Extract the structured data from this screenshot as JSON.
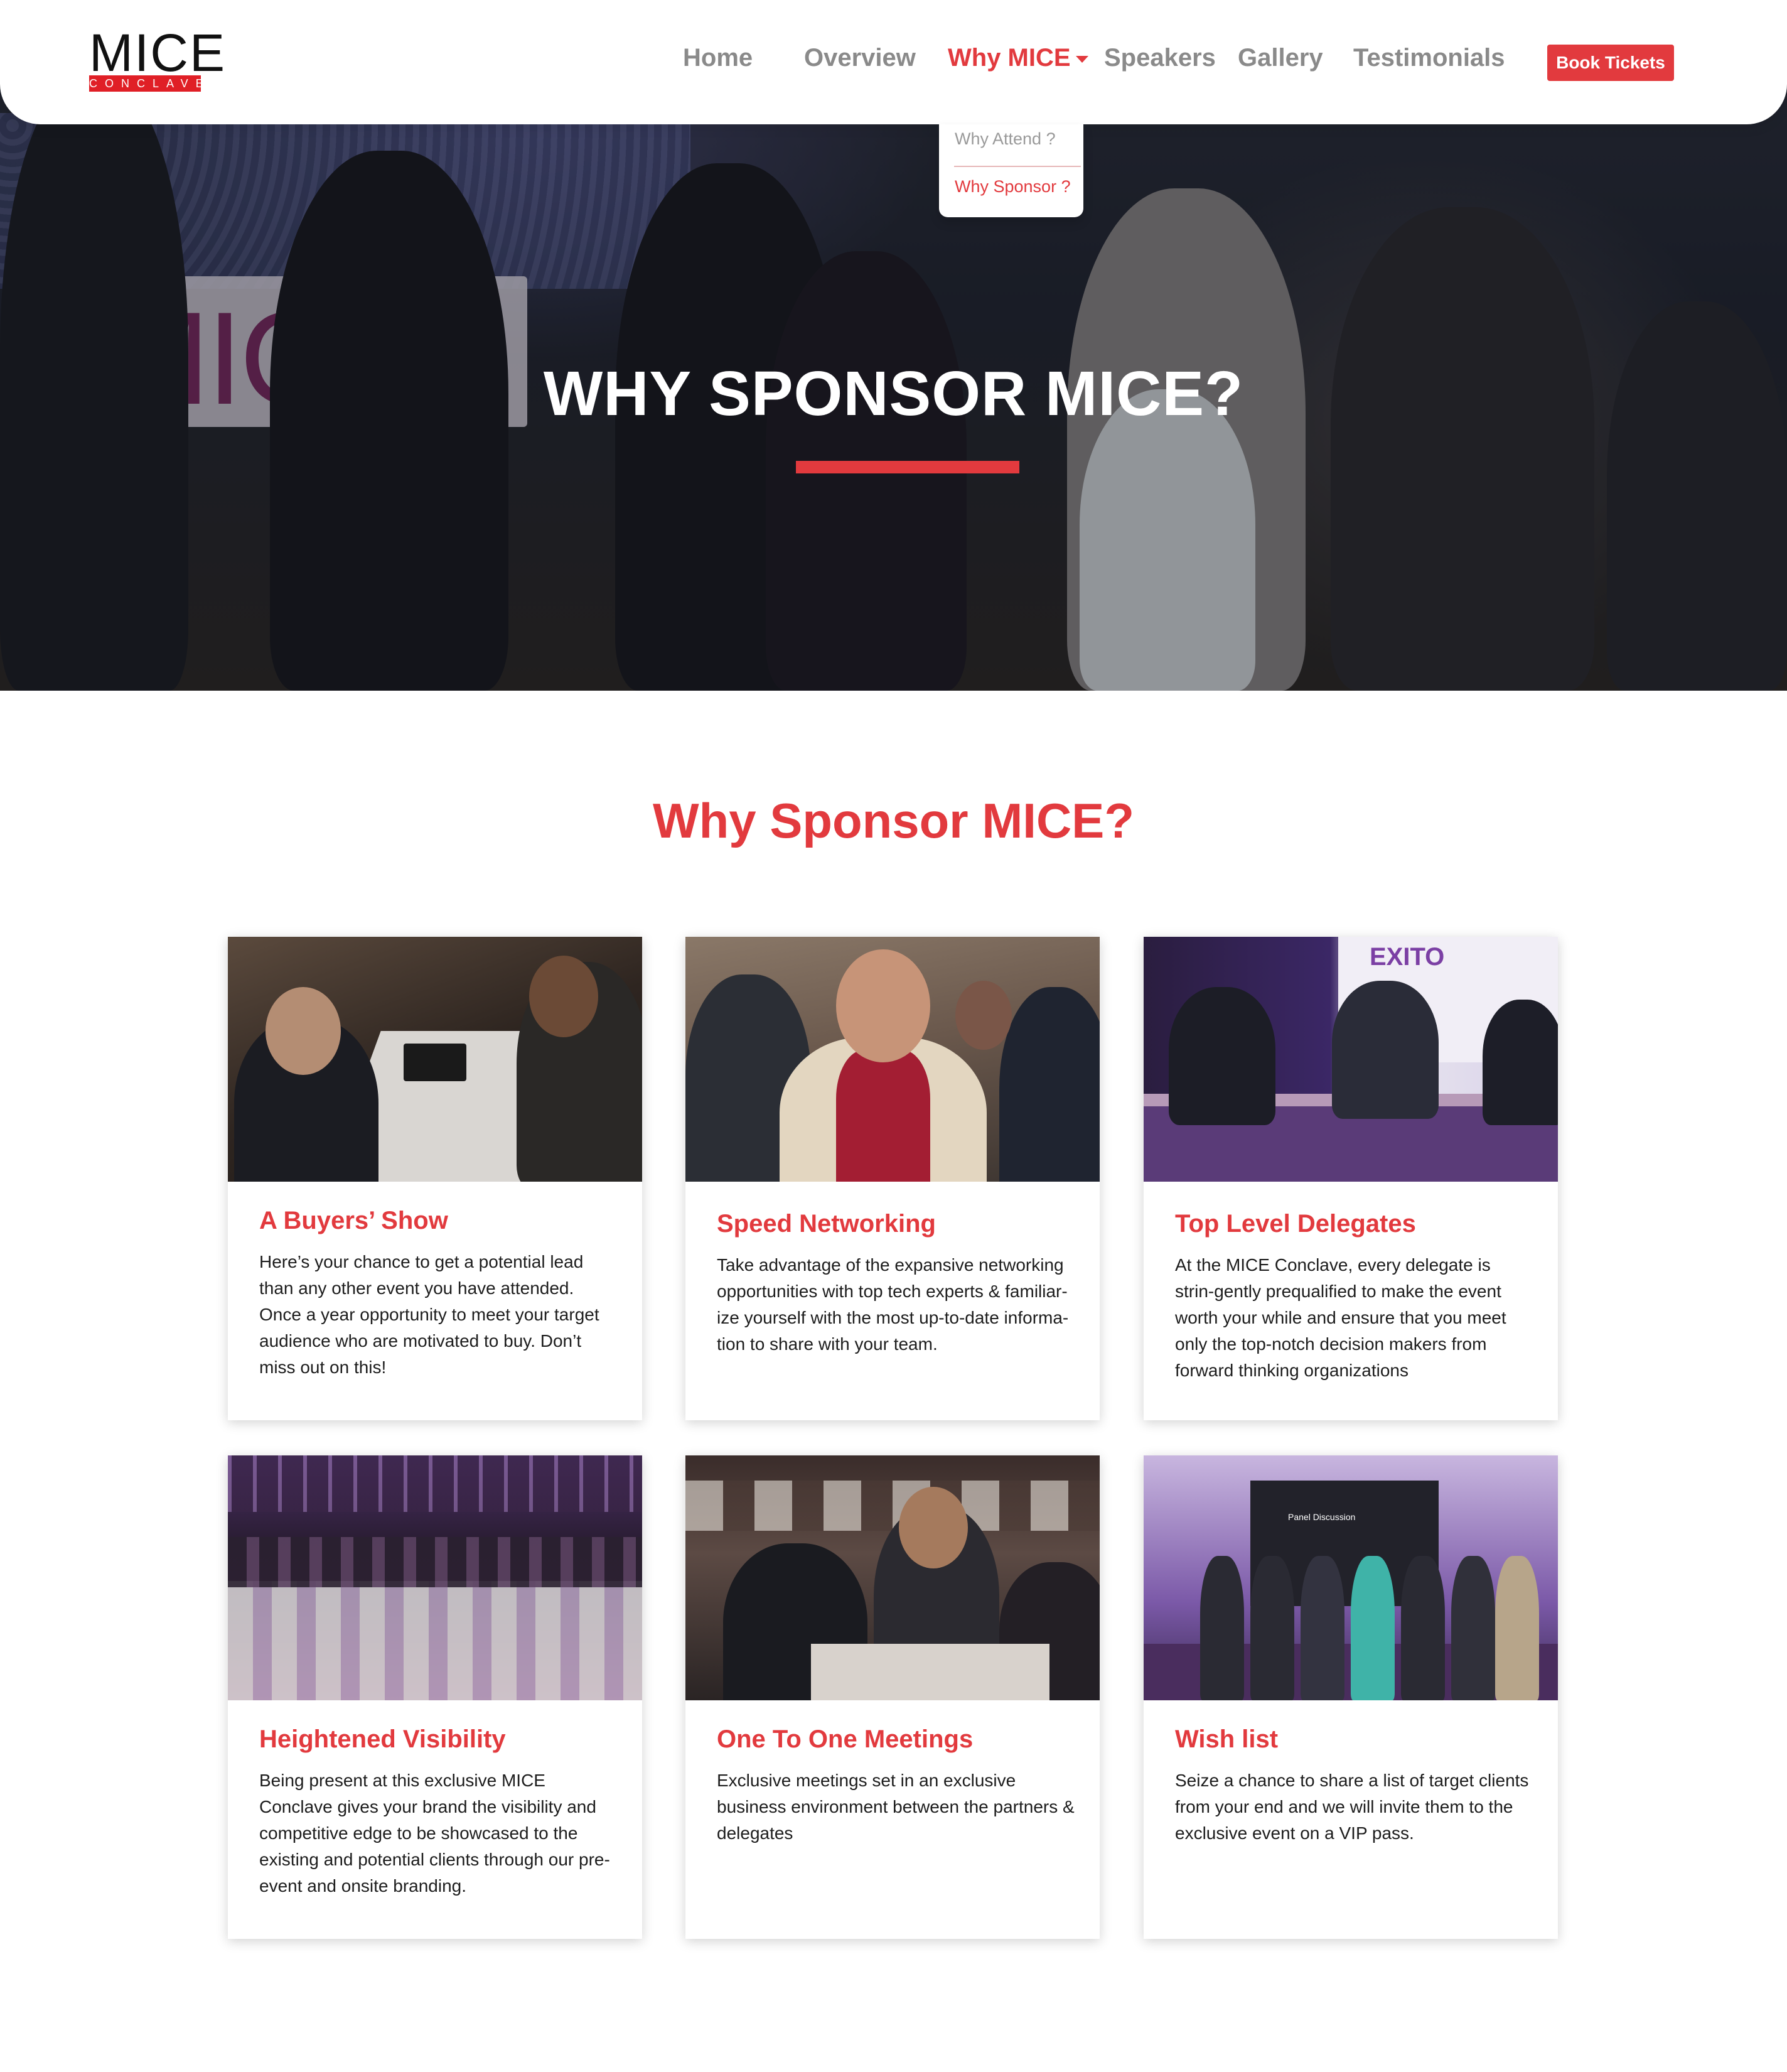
{
  "header": {
    "logo": {
      "word": "MICE",
      "sub": "CONCLAVE"
    },
    "nav": [
      {
        "label": "Home"
      },
      {
        "label": "Overview"
      },
      {
        "label": "Why MICE",
        "active": true
      },
      {
        "label": "Speakers"
      },
      {
        "label": "Gallery"
      },
      {
        "label": "Testimonials"
      }
    ],
    "book_button": "Book Tickets",
    "dropdown": [
      {
        "label": "Why Attend ?"
      },
      {
        "label": "Why Sponsor ?"
      }
    ]
  },
  "hero": {
    "title": "WHY SPONSOR MICE?",
    "backdrop_text": "MICE"
  },
  "section": {
    "title": "Why Sponsor MICE?"
  },
  "cards": [
    {
      "title": "A Buyers’ Show",
      "text": "Here’s your chance to get a potential lead than any other event you have attended. Once a year opportunity to meet your target audience who are motivated to buy. Don’t miss out on this!"
    },
    {
      "title": "Speed Networking",
      "text": "Take advantage of the expansive networking opportunities with top tech experts & familiar-ize yourself with the most up-to-date informa-tion to share with your team."
    },
    {
      "title": "Top Level Delegates",
      "text": "At the MICE Conclave, every delegate is strin-gently prequalified to make the event worth your while and ensure that you meet only the top-notch decision makers from forward thinking organizations",
      "image_sign": "EXITO"
    },
    {
      "title": "Heightened Visibility",
      "text": "Being present at this exclusive MICE Conclave gives your brand the visibility and competitive edge to be showcased to the existing and potential clients through our pre-event and onsite branding."
    },
    {
      "title": "One To One Meetings",
      "text": "Exclusive meetings set in an exclusive business environment between the partners & delegates"
    },
    {
      "title": "Wish list",
      "text": "Seize a chance to share a list of target clients from your end and we will invite them to the exclusive event on a VIP pass.",
      "image_sign": "Panel Discussion"
    }
  ],
  "colors": {
    "accent": "#e23a3e",
    "nav_inactive": "#8a8a8a",
    "text": "#1d1d1d"
  }
}
